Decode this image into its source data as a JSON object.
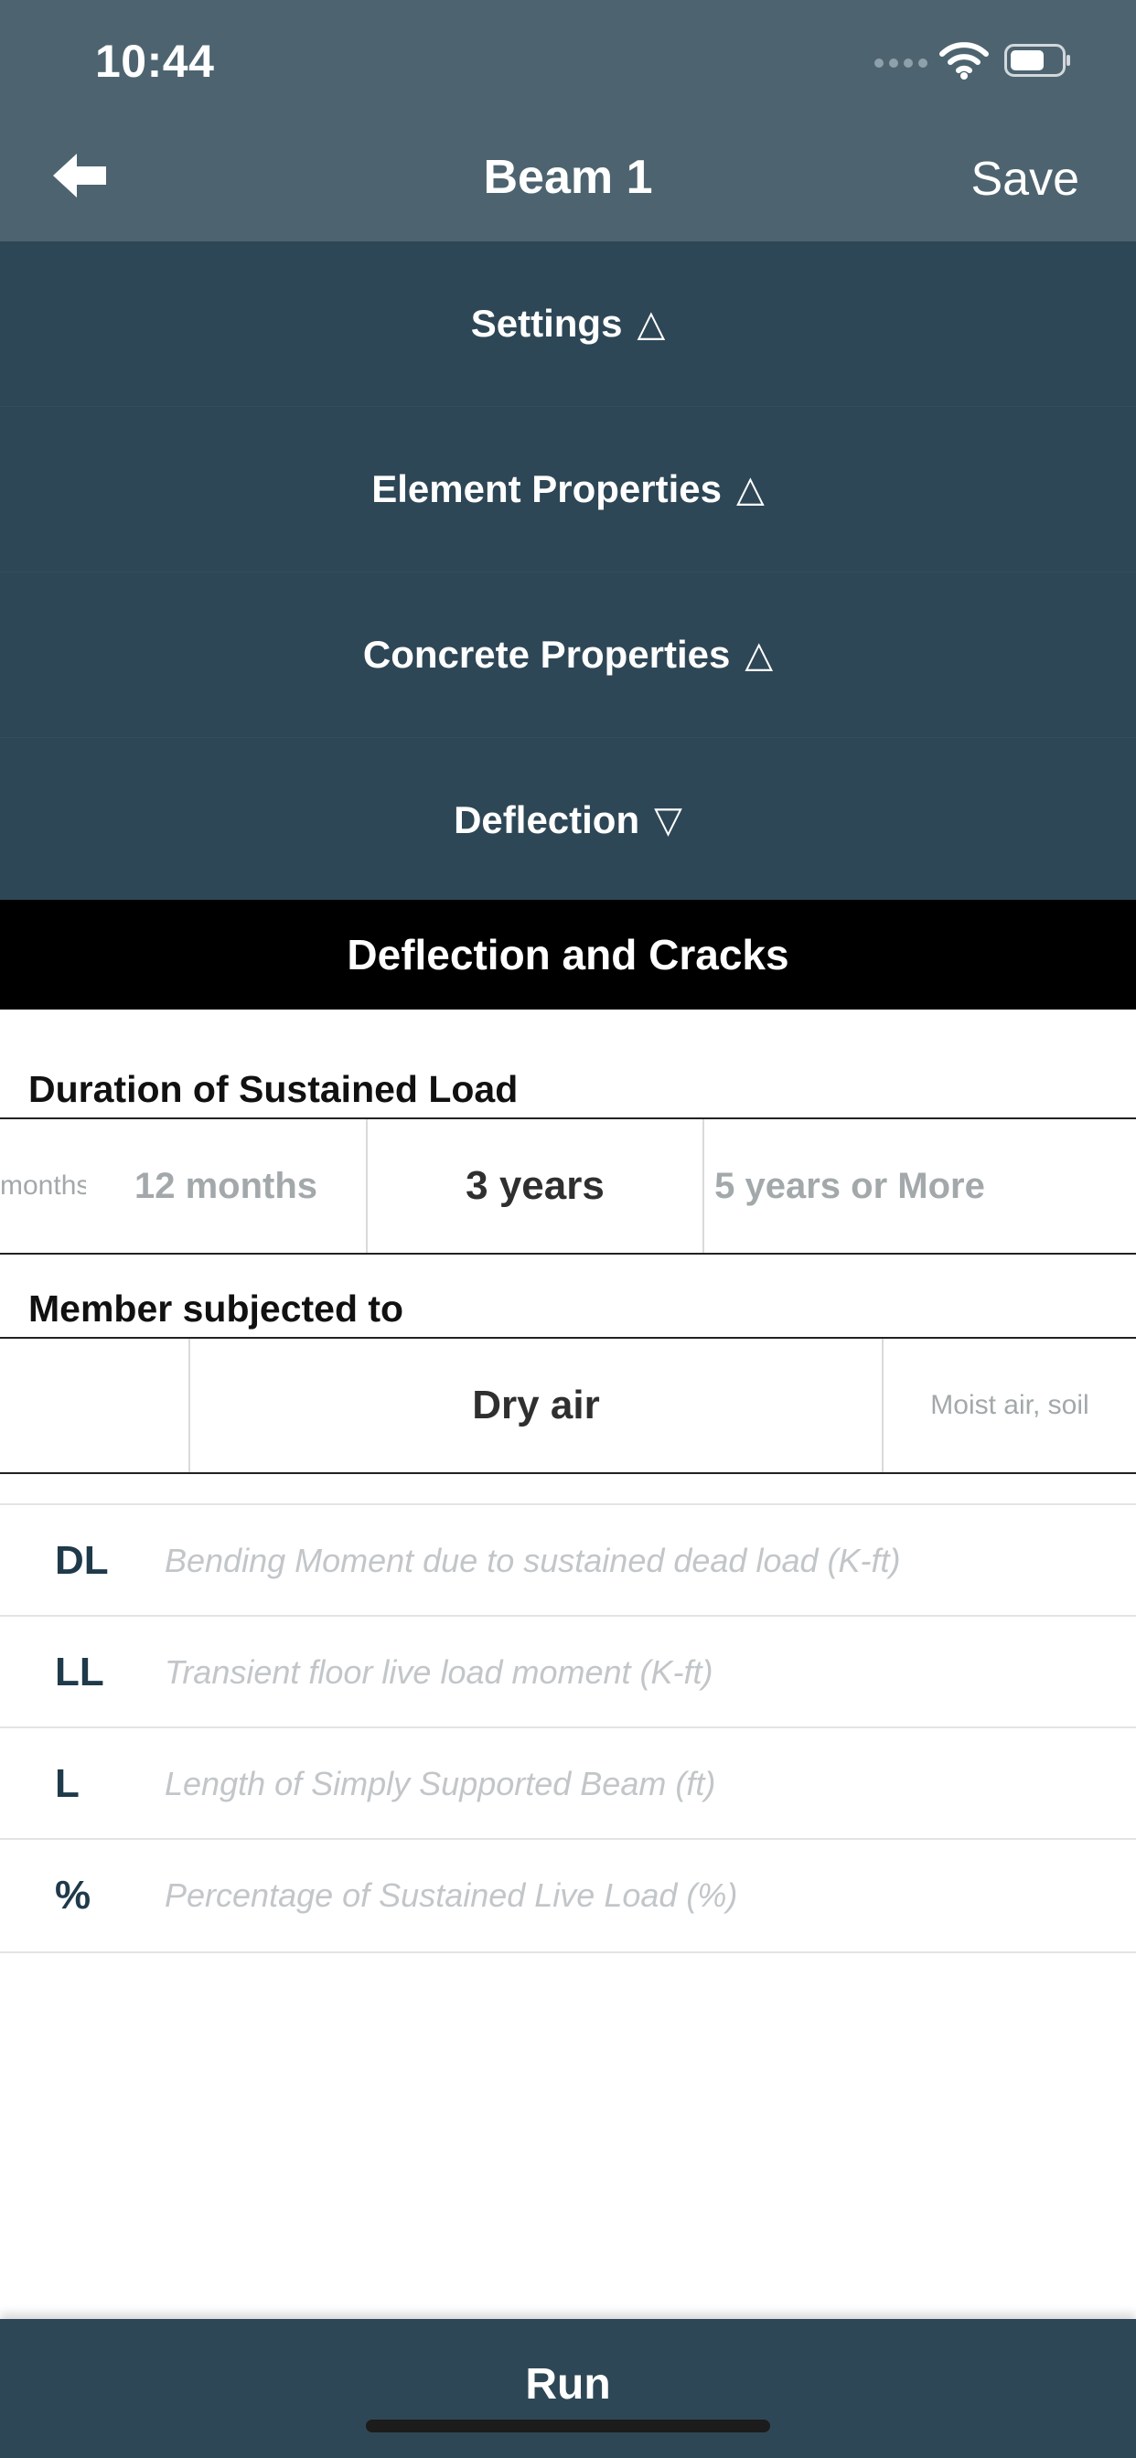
{
  "status_bar": {
    "time": "10:44"
  },
  "nav": {
    "title": "Beam 1",
    "save_label": "Save",
    "back_icon": "back-arrow-icon"
  },
  "sections": [
    {
      "label": "Settings",
      "indicator": "△"
    },
    {
      "label": "Element Properties",
      "indicator": "△"
    },
    {
      "label": "Concrete Properties",
      "indicator": "△"
    },
    {
      "label": "Deflection",
      "indicator": "▽"
    }
  ],
  "deflection": {
    "header": "Deflection and Cracks",
    "duration": {
      "label": "Duration of Sustained Load",
      "options": [
        "months",
        "12 months",
        "3 years",
        "5 years or More"
      ],
      "selected": "3 years"
    },
    "member": {
      "label": "Member subjected to",
      "options": [
        "",
        "Dry air",
        "Moist air, soil"
      ],
      "selected": "Dry air"
    },
    "inputs": [
      {
        "code": "DL",
        "placeholder": "Bending Moment due to sustained dead load (K-ft)",
        "value": ""
      },
      {
        "code": "LL",
        "placeholder": "Transient floor live load moment (K-ft)",
        "value": ""
      },
      {
        "code": "L",
        "placeholder": "Length of Simply Supported Beam (ft)",
        "value": ""
      },
      {
        "code": "%",
        "placeholder": "Percentage of Sustained Live Load (%)",
        "value": ""
      }
    ]
  },
  "footer": {
    "run_label": "Run"
  },
  "colors": {
    "nav_bg": "#4d6470",
    "section_bg": "#2e4756",
    "header_bg": "#000000"
  }
}
